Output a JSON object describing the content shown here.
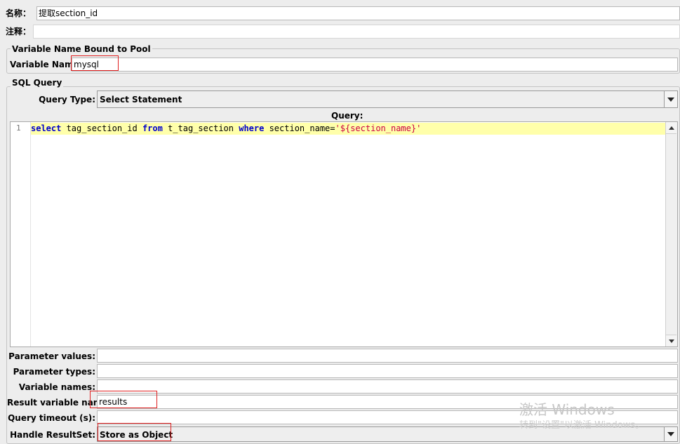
{
  "name": {
    "label": "名称：",
    "value": "提取section_id"
  },
  "comments": {
    "label": "注释：",
    "value": ""
  },
  "pool": {
    "legend": "Variable Name Bound to Pool",
    "var_label": "Variable Name:",
    "var_value": "mysql"
  },
  "sql": {
    "legend": "SQL Query",
    "query_type_label": "Query Type:",
    "query_type_value": "Select Statement",
    "query_label": "Query:",
    "line_number": "1",
    "code": {
      "kw1": "select",
      "t1": " tag_section_id ",
      "kw2": "from",
      "t2": " t_tag_section ",
      "kw3": "where",
      "t3": " section_name=",
      "str1": "'${section_name}'"
    }
  },
  "params": {
    "param_values_label": "Parameter values:",
    "param_values_value": "",
    "param_types_label": "Parameter types:",
    "param_types_value": "",
    "variable_names_label": "Variable names:",
    "variable_names_value": "",
    "result_var_label": "Result variable name:",
    "result_var_value": "results",
    "timeout_label": "Query timeout (s):",
    "timeout_value": "",
    "handle_label": "Handle ResultSet:",
    "handle_value": "Store as Object"
  },
  "watermark": {
    "line1": "激活 Windows",
    "line2": "转到\"设置\"以激活 Windows。"
  },
  "colors": {
    "highlight_box": "#e02020",
    "current_line": "#ffffaa",
    "keyword": "#0000cc",
    "string": "#cc0044"
  }
}
